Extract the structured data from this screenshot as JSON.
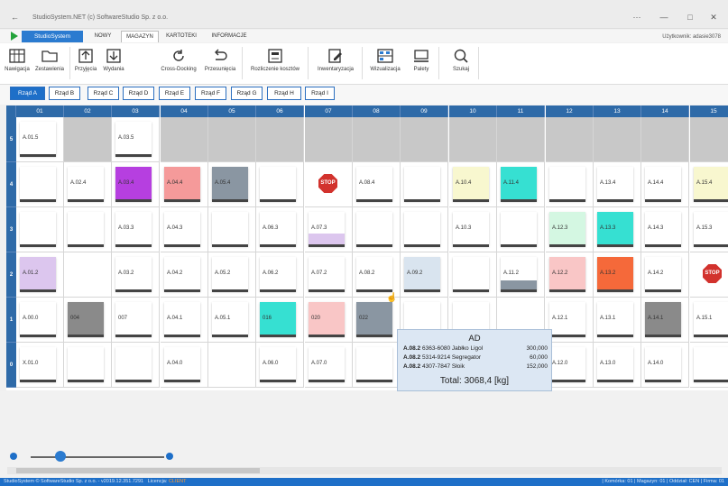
{
  "window": {
    "title": "StudioSystem.NET (c) SoftwareStudio Sp. z o.o.",
    "back_icon": "←",
    "controls": [
      "···",
      "—",
      "□",
      "✕"
    ]
  },
  "menu": {
    "app_button": "StudioSystem",
    "tabs": [
      "NOWY",
      "MAGAZYN",
      "KARTOTEKI",
      "INFORMACJE"
    ],
    "active_tab": "MAGAZYN",
    "user": "Użytkownik: adasie3078"
  },
  "ribbon": [
    {
      "label": "Nawigacja",
      "icon": "navigation-icon"
    },
    {
      "label": "Zestawienia",
      "icon": "folder-icon"
    },
    {
      "label": "Przyjęcia",
      "icon": "upload-icon"
    },
    {
      "label": "Wydania",
      "icon": "download-icon"
    },
    {
      "label": "Cross-Docking",
      "icon": "refresh-icon"
    },
    {
      "label": "Przesunięcia",
      "icon": "undo-icon"
    },
    {
      "label": "Rozliczenie kosztów",
      "icon": "calculator-icon"
    },
    {
      "label": "Inwentaryzacja",
      "icon": "edit-icon"
    },
    {
      "label": "Wizualizacja",
      "icon": "warehouse-icon"
    },
    {
      "label": "Palety",
      "icon": "pallet-icon"
    },
    {
      "label": "Szukaj",
      "icon": "search-icon"
    }
  ],
  "row_tabs": [
    "Rząd A",
    "Rząd B",
    "Rząd C",
    "Rząd D",
    "Rząd E",
    "Rząd F",
    "Rząd G",
    "Rząd H",
    "Rząd I"
  ],
  "active_row_tab": "Rząd A",
  "grid": {
    "columns": [
      "01",
      "02",
      "03",
      "04",
      "05",
      "06",
      "07",
      "08",
      "09",
      "10",
      "11",
      "12",
      "13",
      "14",
      "15"
    ],
    "levels": [
      "5",
      "4",
      "3",
      "2",
      "1",
      "0"
    ],
    "colors": {
      "gray": "#c8c8c8",
      "purple": "#b63fe0",
      "salmon": "#f59a9a",
      "slate": "#8a96a2",
      "lavender": "#dcc6ee",
      "teal": "#36e0d2",
      "lightgreen": "#d4f7e2",
      "pink": "#f9c6c6",
      "orange": "#f5693a",
      "yellow": "#f8f7cf",
      "lightblue": "#d9e4ef",
      "darkgray": "#8a8a8a"
    },
    "cells": {
      "5": [
        "A.01.5",
        "",
        "A.03.5",
        "",
        "",
        "",
        "",
        "",
        "",
        "",
        "",
        "",
        "",
        "",
        ""
      ],
      "4": [
        "",
        "A.02.4",
        "A.03.4",
        "A.04.4",
        "A.05.4",
        "",
        "STOP",
        "A.08.4",
        "",
        "A.10.4",
        "A.11.4",
        "",
        "A.13.4",
        "A.14.4",
        "A.15.4"
      ],
      "3": [
        "",
        "",
        "A.03.3",
        "A.04.3",
        "",
        "A.06.3",
        "A.07.3",
        "",
        "",
        "A.10.3",
        "",
        "A.12.3",
        "A.13.3",
        "A.14.3",
        "A.15.3"
      ],
      "2": [
        "A.01.2",
        "",
        "A.03.2",
        "A.04.2",
        "A.05.2",
        "A.06.2",
        "A.07.2",
        "A.08.2",
        "A.09.2",
        "",
        "A.11.2",
        "A.12.2",
        "A.13.2",
        "A.14.2",
        "STOP"
      ],
      "1": [
        "A.00.0",
        "004",
        "007",
        "A.04.1",
        "A.05.1",
        "016",
        "020",
        "022",
        "",
        "",
        "",
        "A.12.1",
        "A.13.1",
        "A.14.1",
        "A.15.1"
      ],
      "0": [
        "X.01.0",
        "",
        "",
        "A.04.0",
        "",
        "A.06.0",
        "A.07.0",
        "",
        "",
        "",
        "",
        "A.12.0",
        "A.13.0",
        "A.14.0",
        ""
      ]
    }
  },
  "tooltip": {
    "header": "AD",
    "rows": [
      {
        "loc": "A.08.2",
        "desc": "6363-6080 Jabłko Ligol",
        "qty": "300,000"
      },
      {
        "loc": "A.08.2",
        "desc": "5314-9214 Segregator",
        "qty": "60,000"
      },
      {
        "loc": "A.08.2",
        "desc": "4307-7847 Słoik",
        "qty": "152,000"
      }
    ],
    "total": "Total: 3068,4 [kg]"
  },
  "zoom_slider": {
    "level": 0.22
  },
  "status": {
    "left": "StudioSystem © SoftwareStudio Sp. z o.o. - v2019.12.351.7291",
    "license_label": "Licencja:",
    "license_value": "CLIENT",
    "right": "| Komórka: 01 | Magazyn: 01 | Oddział: CEN | Firma: 01"
  }
}
